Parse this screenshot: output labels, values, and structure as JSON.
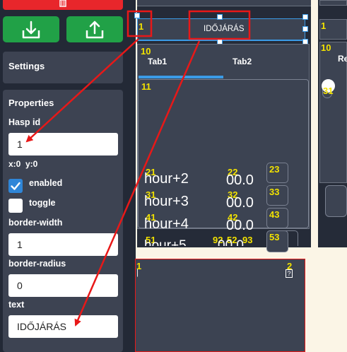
{
  "settings": {
    "title": "Settings"
  },
  "properties": {
    "title": "Properties",
    "hasp_id_label": "Hasp id",
    "hasp_id_value": "1",
    "coords": "x:0  y:0",
    "enabled_label": "enabled",
    "toggle_label": "toggle",
    "border_width_label": "border-width",
    "border_width_value": "1",
    "border_radius_label": "border-radius",
    "border_radius_value": "0",
    "text_label": "text",
    "text_value": "IDŐJÁRÁS"
  },
  "canvas": {
    "header_text": "IDŐJÁRÁS",
    "header_id": "1",
    "tabs": [
      "Tab1",
      "Tab2"
    ],
    "tabview_id": "10",
    "content_id": "11",
    "rows": [
      {
        "hour": "hour+2",
        "value": "00.0",
        "ids": [
          "21",
          "22",
          "23"
        ]
      },
      {
        "hour": "hour+3",
        "value": "00.0",
        "ids": [
          "31",
          "32",
          "33"
        ]
      },
      {
        "hour": "hour+4",
        "value": "00.0",
        "ids": [
          "41",
          "42",
          "43"
        ]
      },
      {
        "hour": "hour+5",
        "value": "00.0",
        "ids": [
          "51",
          "52",
          "53"
        ]
      }
    ],
    "overlap_ids": [
      "92",
      "93"
    ],
    "right_ids": [
      "1",
      "10",
      "31"
    ],
    "right_text": "Re",
    "bottom_ids": [
      "1",
      "2"
    ]
  },
  "colors": {
    "accent_blue": "#3b9be6",
    "annotation_red": "#e81818",
    "id_yellow": "#f2e200",
    "button_green": "#21a147",
    "button_red": "#e8262b"
  },
  "icons": [
    "trash-icon",
    "download-icon",
    "upload-icon",
    "check-icon"
  ]
}
